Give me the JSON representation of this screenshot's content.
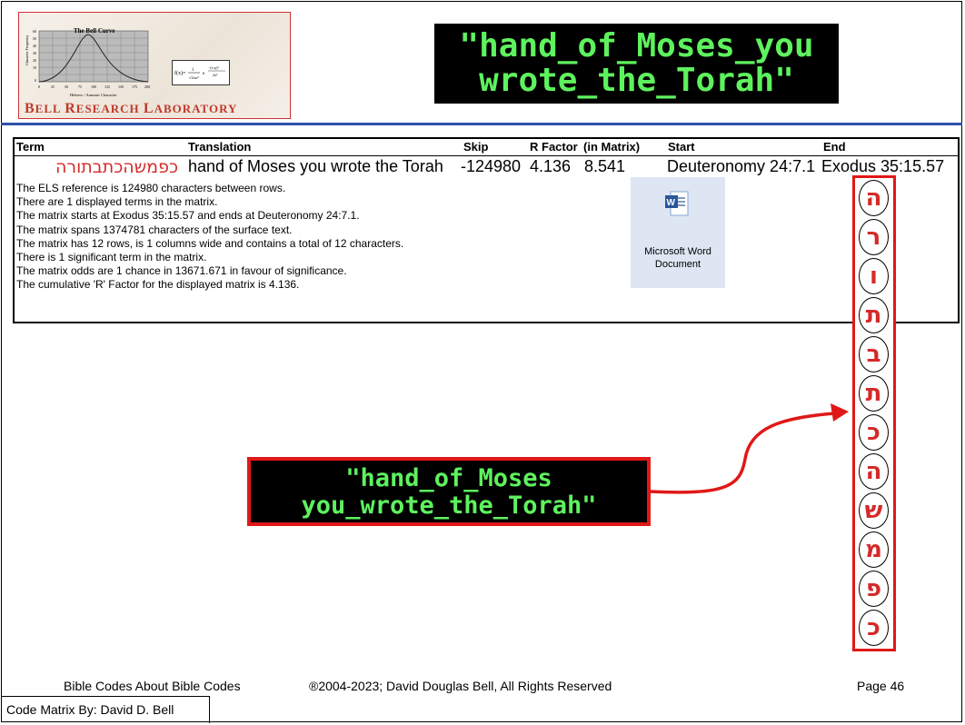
{
  "logo": {
    "chart_title": "The Bell Curve",
    "y_axis_label": "Character Frequency",
    "x_axis_label": "Hebrew / Aramaic Character",
    "x_ticks": [
      "0",
      "25",
      "50",
      "75",
      "100",
      "125",
      "150",
      "175",
      "200"
    ],
    "y_ticks": [
      "60",
      "50",
      "40",
      "30",
      "20",
      "10",
      "0"
    ],
    "brand_b": "B",
    "brand_ell": "ELL",
    "brand_r": "R",
    "brand_esearch": "ESEARCH",
    "brand_l": "L",
    "brand_aboratory": "ABORATORY"
  },
  "title_lines": [
    "\"hand_of_Moses_you",
    "wrote_the_Torah\""
  ],
  "table": {
    "headers": {
      "term": "Term",
      "translation": "Translation",
      "skip": "Skip",
      "r_factor": "R Factor",
      "in_matrix": "(in Matrix)",
      "start": "Start",
      "end": "End"
    },
    "row": {
      "term": "כפמשהכתבתורה",
      "translation": "hand of Moses you wrote the Torah",
      "skip": "-124980",
      "r_factor": "4.136",
      "in_matrix": "8.541",
      "start": "Deuteronomy 24:7.1",
      "end": "Exodus 35:15.57"
    }
  },
  "notes": [
    "The ELS reference is 124980 characters between rows.",
    "There are 1 displayed terms in the matrix.",
    "The matrix starts at Exodus 35:15.57 and ends at Deuteronomy 24:7.1.",
    "The matrix spans 1374781 characters of the surface text.",
    "The matrix has 12 rows, is 1 columns wide and contains a total of 12 characters.",
    "There is 1 significant term in the matrix.",
    "The matrix odds are 1 chance in 13671.671 in favour of significance.",
    "The cumulative 'R' Factor for the displayed matrix is 4.136."
  ],
  "embedded_object": {
    "line1": "Microsoft Word",
    "line2": "Document",
    "icon": "word-document-icon"
  },
  "matrix_letters": [
    "ה",
    "ר",
    "ו",
    "ת",
    "ב",
    "ת",
    "כ",
    "ה",
    "ש",
    "מ",
    "פ",
    "כ"
  ],
  "callout_lines": [
    "\"hand_of_Moses",
    "you_wrote_the_Torah\""
  ],
  "footer": {
    "left": "Bible Codes About Bible Codes",
    "center": "®2004-2023; David Douglas Bell, All Rights Reserved",
    "right": "Page 46",
    "credit": "Code Matrix By: David D. Bell"
  },
  "colors": {
    "accent_red": "#e01818",
    "hebrew_red": "#d42a2a",
    "terminal_green": "#5ef25e",
    "rule_blue": "#2f4fa8"
  }
}
